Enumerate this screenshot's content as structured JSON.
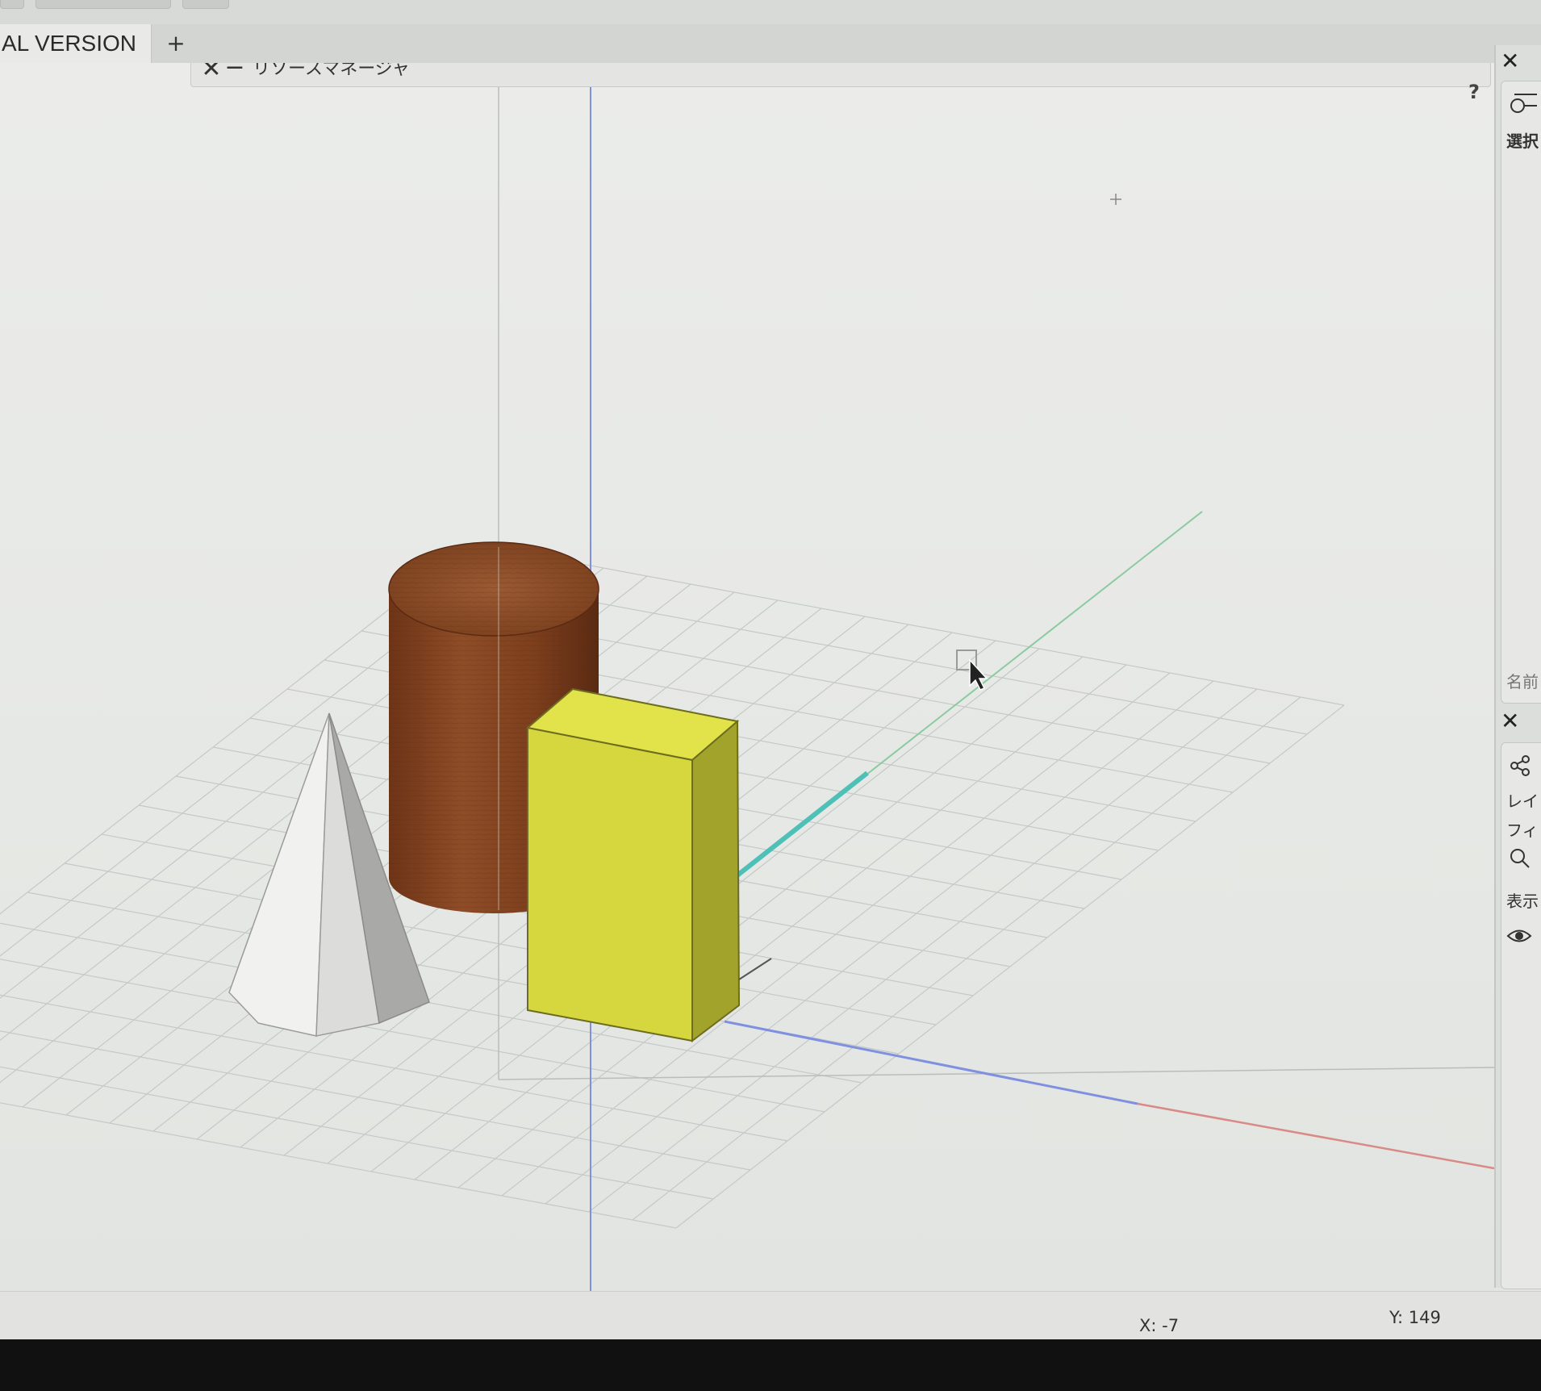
{
  "document_tab": {
    "label": "AL VERSION",
    "add_label": "+"
  },
  "resource_manager": {
    "title": "リソースマネージャ",
    "close_glyph": "✕",
    "minimize_glyph": "−",
    "help_label": "?"
  },
  "right_panel": {
    "select_label": "選択",
    "name_label": "名前",
    "layer_label": "レイ",
    "filter_label": "フィ",
    "display_label": "表示",
    "close_glyph": "✕"
  },
  "status_bar": {
    "x_label": "X: -7",
    "y_label": "Y: 149"
  },
  "colors": {
    "cylinder": "#8a4a24",
    "box_front": "#d6d63e",
    "box_top": "#e4e54c",
    "box_side": "#9fa12a",
    "cone_light": "#f0f0ef",
    "cone_shadow": "#a8a8a6",
    "axis_x": "#d98a86",
    "axis_y": "#7fc39a",
    "axis_z": "#7f8fe0",
    "grid": "#c6cac8"
  },
  "scene_objects": [
    "cylinder",
    "box",
    "cone"
  ]
}
